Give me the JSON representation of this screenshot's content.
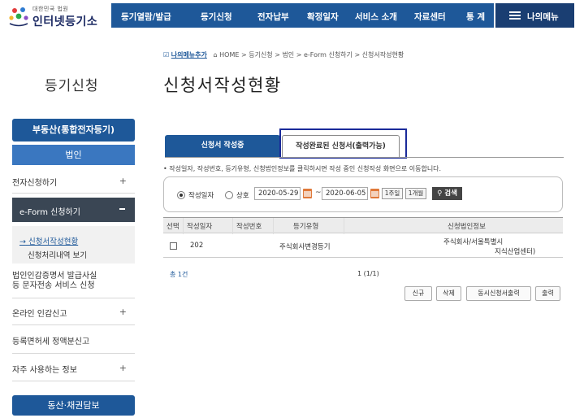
{
  "header": {
    "logo_small": "대한민국 법원",
    "logo_big": "인터넷등기소",
    "nav": [
      "등기열람/발급",
      "등기신청",
      "전자납부",
      "확정일자",
      "서비스 소개",
      "자료센터",
      "통 계"
    ],
    "my_menu": "나의메뉴"
  },
  "sidebar": {
    "section_title": "등기신청",
    "top_button": "부동산(통합전자등기)",
    "sub_button": "법인",
    "items": [
      {
        "label": "전자신청하기",
        "expand": "+"
      },
      {
        "label": "e-Form 신청하기",
        "expand": "−"
      },
      {
        "label": "법인인감증명서 발급사실 등 문자전송 서비스 신청",
        "line1": "법인인감증명서 발급사실",
        "line2": "등 문자전송 서비스 신청"
      },
      {
        "label": "온라인 인감신고",
        "expand": "+"
      },
      {
        "label": "등록면허세 정액분신고"
      },
      {
        "label": "자주 사용하는 정보",
        "expand": "+"
      }
    ],
    "sub_items": [
      "신청서작성현황",
      "신청처리내역 보기"
    ],
    "sub_arrow": "→",
    "bottom_button": "동산·채권담보"
  },
  "breadcrumb": {
    "favorite": "나의메뉴추가",
    "path": "HOME > 등기신청 > 법인 > e-Form 신청하기 > 신청서작성현황"
  },
  "main": {
    "title": "신청서작성현황",
    "tabs": [
      "신청서 작성중",
      "작성완료된 신청서(출력가능)"
    ],
    "note": "• 작성일자, 작성번호, 등기유형, 신청법인정보를 클릭하시면 작성 중인 신청작성 화면으로 이동합니다.",
    "search": {
      "radio1": "작성일자",
      "radio2": "상호",
      "date_from": "2020-05-29",
      "date_to": "2020-06-05",
      "tilde": "~",
      "btn_week": "1주일",
      "btn_month": "1개월",
      "btn_search": "검색"
    },
    "table": {
      "headers": [
        "선택",
        "작성일자",
        "작성번호",
        "등기유형",
        "신청법인정보"
      ],
      "rows": [
        {
          "date": "202",
          "number": "",
          "type": "주식회사변경등기",
          "info1": "주식회사/서울특별시",
          "info2": "지식산업센터)"
        }
      ]
    },
    "total": "총 1건",
    "pager": "1  (1/1)",
    "actions": [
      "신규",
      "삭제",
      "동시신청서출력",
      "출력"
    ]
  }
}
